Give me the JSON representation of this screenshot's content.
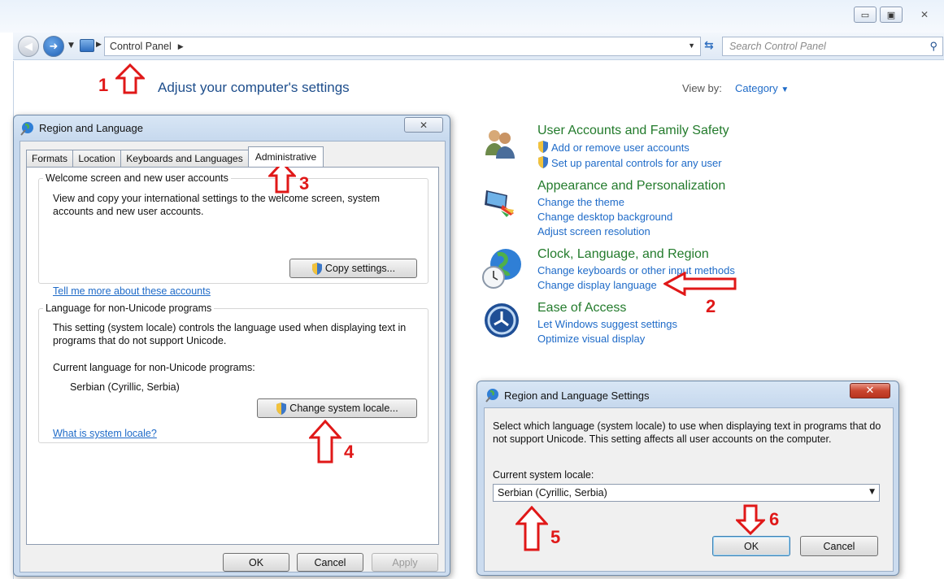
{
  "explorer": {
    "address_root": "Control Panel",
    "search_placeholder": "Search Control Panel",
    "window_controls": {
      "minimize": "▭",
      "maximize": "▣",
      "close": "✕"
    }
  },
  "control_panel": {
    "heading": "Adjust your computer's settings",
    "view_by_label": "View by:",
    "view_by_value": "Category",
    "categories": [
      {
        "title": "User Accounts and Family Safety",
        "icon": "users-icon",
        "links": [
          "Add or remove user accounts",
          "Set up parental controls for any user"
        ]
      },
      {
        "title": "Appearance and Personalization",
        "icon": "display-paint-icon",
        "links": [
          "Change the theme",
          "Change desktop background",
          "Adjust screen resolution"
        ]
      },
      {
        "title": "Clock, Language, and Region",
        "icon": "globe-clock-icon",
        "links": [
          "Change keyboards or other input methods",
          "Change display language"
        ]
      },
      {
        "title": "Ease of Access",
        "icon": "ease-of-access-icon",
        "links": [
          "Let Windows suggest settings",
          "Optimize visual display"
        ]
      }
    ]
  },
  "region_dialog": {
    "title": "Region and Language",
    "close": "✕",
    "tabs": [
      "Formats",
      "Location",
      "Keyboards and Languages",
      "Administrative"
    ],
    "active_tab": "Administrative",
    "welcome_group": {
      "title": "Welcome screen and new user accounts",
      "description": "View and copy your international settings to the welcome screen, system accounts and new user accounts.",
      "button": "Copy settings...",
      "link": "Tell me more about these accounts"
    },
    "unicode_group": {
      "title": "Language for non-Unicode programs",
      "description": "This setting (system locale) controls the language used when displaying text in programs that do not support Unicode.",
      "current_label": "Current language for non-Unicode programs:",
      "current_value": "Serbian (Cyrillic, Serbia)",
      "button": "Change system locale...",
      "link": "What is system locale?"
    },
    "buttons": {
      "ok": "OK",
      "cancel": "Cancel",
      "apply": "Apply"
    }
  },
  "settings_dialog": {
    "title": "Region and Language Settings",
    "close": "✕",
    "description": "Select which language (system locale) to use when displaying text in programs that do not support Unicode. This setting affects all user accounts on the computer.",
    "locale_label": "Current system locale:",
    "locale_value": "Serbian (Cyrillic, Serbia)",
    "buttons": {
      "ok": "OK",
      "cancel": "Cancel"
    }
  },
  "annotations": [
    "1",
    "2",
    "3",
    "4",
    "5",
    "6"
  ],
  "colors": {
    "annotation": "#e01818",
    "link": "#1f6bc8",
    "category_title": "#237b2c",
    "heading": "#1e4e8c"
  }
}
